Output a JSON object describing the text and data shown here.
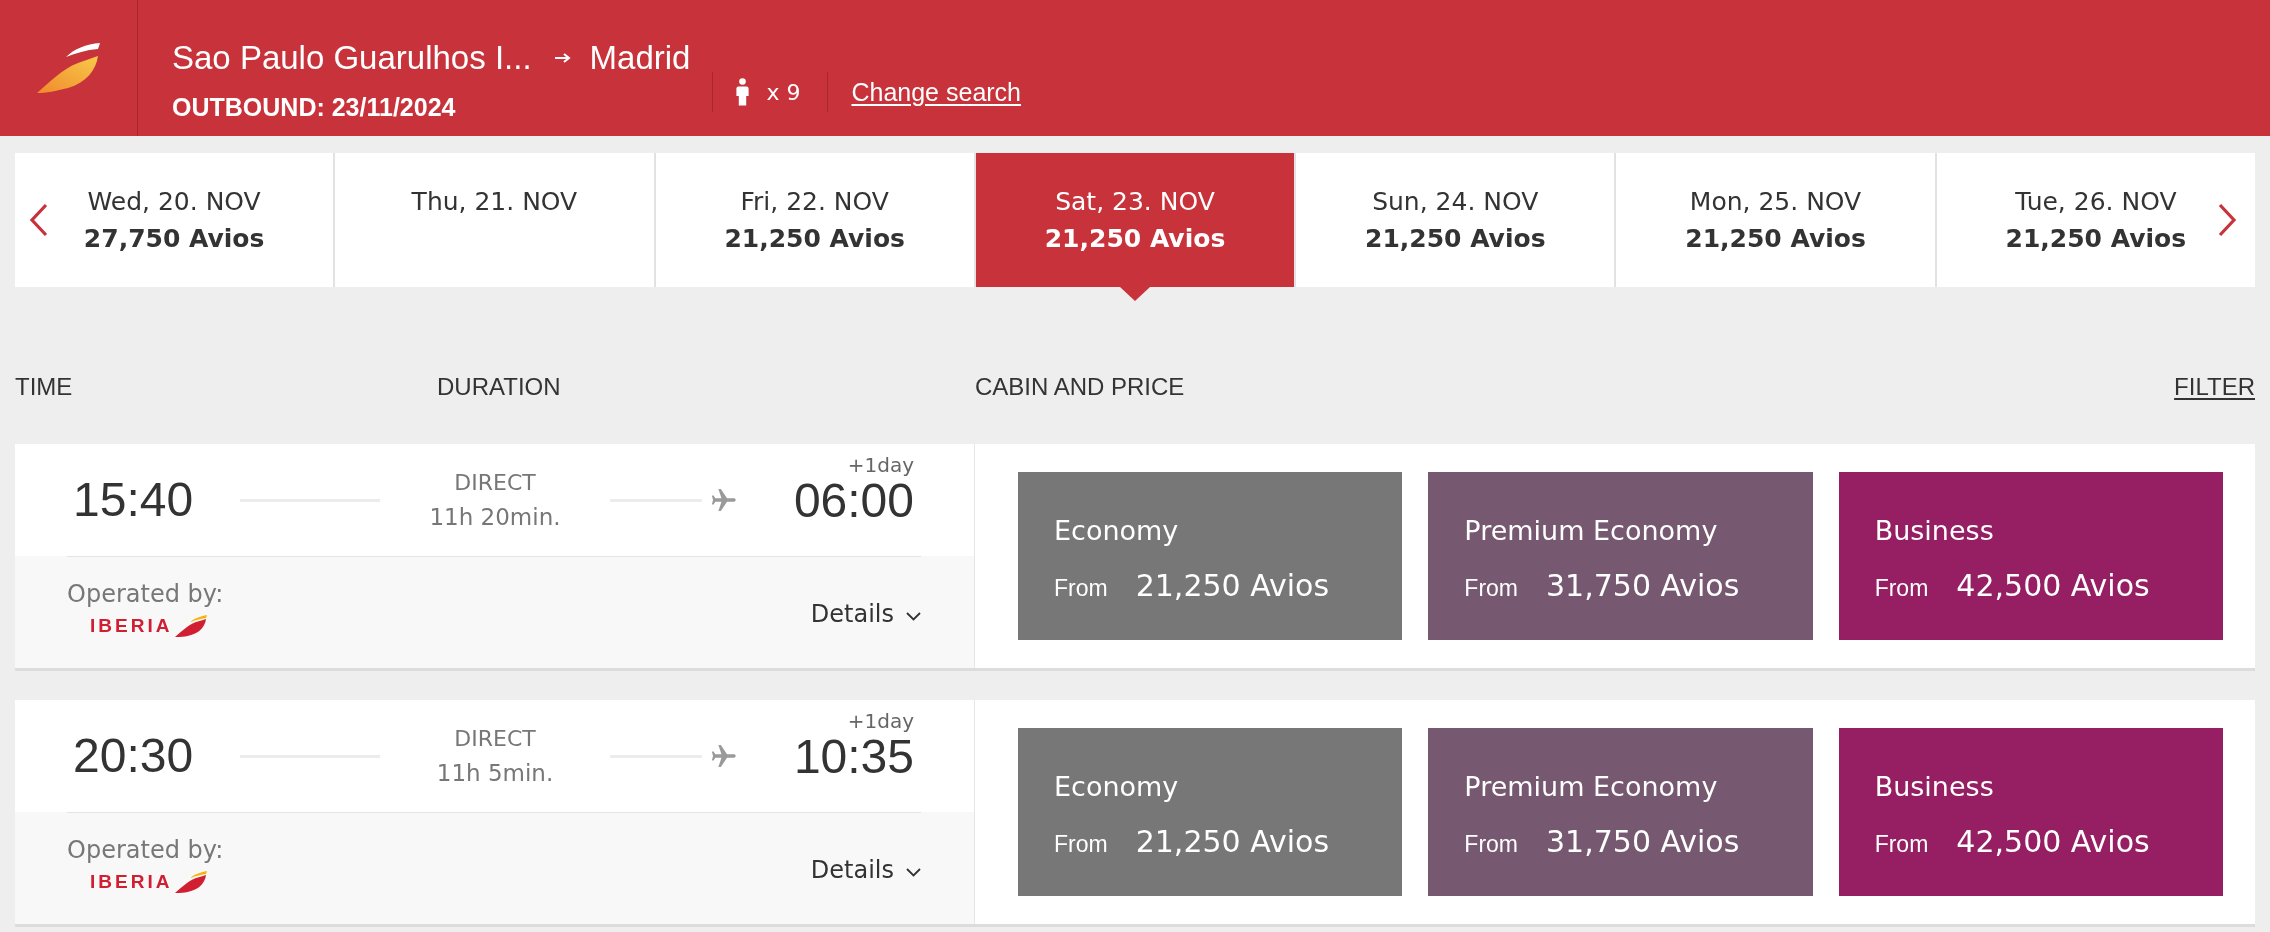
{
  "header": {
    "origin": "Sao Paulo Guarulhos I...",
    "destination": "Madrid",
    "outbound": "OUTBOUND: 23/11/2024",
    "passengers": "x 9",
    "change_search": "Change search"
  },
  "date_strip": [
    {
      "date": "Wed, 20. NOV",
      "price": "27,750 Avios",
      "selected": false
    },
    {
      "date": "Thu, 21. NOV",
      "selected": false
    },
    {
      "date": "Fri, 22. NOV",
      "price": "21,250 Avios",
      "selected": false
    },
    {
      "date": "Sat, 23. NOV",
      "price": "21,250 Avios",
      "selected": true
    },
    {
      "date": "Sun, 24. NOV",
      "price": "21,250 Avios",
      "selected": false
    },
    {
      "date": "Mon, 25. NOV",
      "price": "21,250 Avios",
      "selected": false
    },
    {
      "date": "Tue, 26. NOV",
      "price": "21,250 Avios",
      "selected": false
    }
  ],
  "columns": [
    "TIME",
    "DURATION",
    "CABIN AND PRICE"
  ],
  "filter": "FILTER",
  "flights": [
    {
      "departure": "15:40",
      "stops": "DIRECT",
      "duration": "11h 20min.",
      "day_offset": "+1day",
      "arrival": "06:00",
      "operated_label": "Operated by:",
      "operator": "IBERIA",
      "details": "Details",
      "cabins": [
        {
          "name": "Economy",
          "from": "From",
          "price": "21,250 Avios",
          "color": "#777777"
        },
        {
          "name": "Premium Economy",
          "from": "From",
          "price": "31,750 Avios",
          "color": "#765870"
        },
        {
          "name": "Business",
          "from": "From",
          "price": "42,500 Avios",
          "color": "#951f62"
        }
      ]
    },
    {
      "departure": "20:30",
      "stops": "DIRECT",
      "duration": "11h 5min.",
      "day_offset": "+1day",
      "arrival": "10:35",
      "operated_label": "Operated by:",
      "operator": "IBERIA",
      "details": "Details",
      "cabins": [
        {
          "name": "Economy",
          "from": "From",
          "price": "21,250 Avios",
          "color": "#777777"
        },
        {
          "name": "Premium Economy",
          "from": "From",
          "price": "31,750 Avios",
          "color": "#765870"
        },
        {
          "name": "Business",
          "from": "From",
          "price": "42,500 Avios",
          "color": "#951f62"
        }
      ]
    }
  ]
}
